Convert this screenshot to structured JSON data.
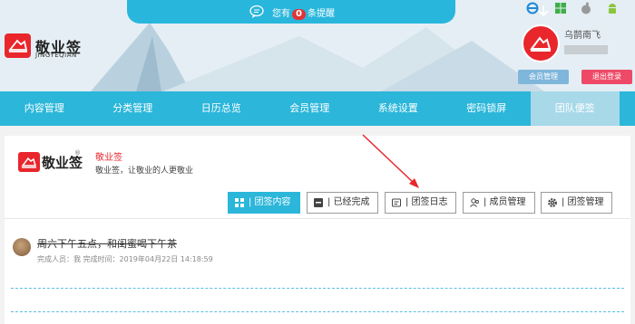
{
  "notice": {
    "prefix": "您有",
    "count": "0",
    "suffix": "条提醒"
  },
  "brand": {
    "name": "敬业签",
    "sub": "JINGYEQIAN"
  },
  "user": {
    "name": "乌鹊南飞",
    "member_button": "会员管理",
    "logout_button": "退出登录"
  },
  "nav": [
    {
      "label": "内容管理"
    },
    {
      "label": "分类管理"
    },
    {
      "label": "日历总览"
    },
    {
      "label": "会员管理"
    },
    {
      "label": "系统设置"
    },
    {
      "label": "密码锁屏"
    },
    {
      "label": "团队便签"
    }
  ],
  "team": {
    "logo_text": "敬业签",
    "title": "敬业签",
    "description": "敬业签，让敬业的人更敬业"
  },
  "tabs": [
    {
      "label": "| 团签内容",
      "icon": "grid-icon"
    },
    {
      "label": "| 已经完成",
      "icon": "archive-icon"
    },
    {
      "label": "| 团签日志",
      "icon": "log-icon"
    },
    {
      "label": "| 成员管理",
      "icon": "members-icon"
    },
    {
      "label": "| 团签管理",
      "icon": "gear-icon"
    }
  ],
  "items": [
    {
      "title": "周六下午五点，和闺蜜喝下午茶",
      "meta": "完成人员：我  完成时间：2019年04月22日 14:18:59"
    }
  ],
  "colors": {
    "accent": "#2bb6da",
    "brand_red": "#e8262c",
    "logout": "#ee4a67",
    "member_btn": "#7fb6db"
  }
}
